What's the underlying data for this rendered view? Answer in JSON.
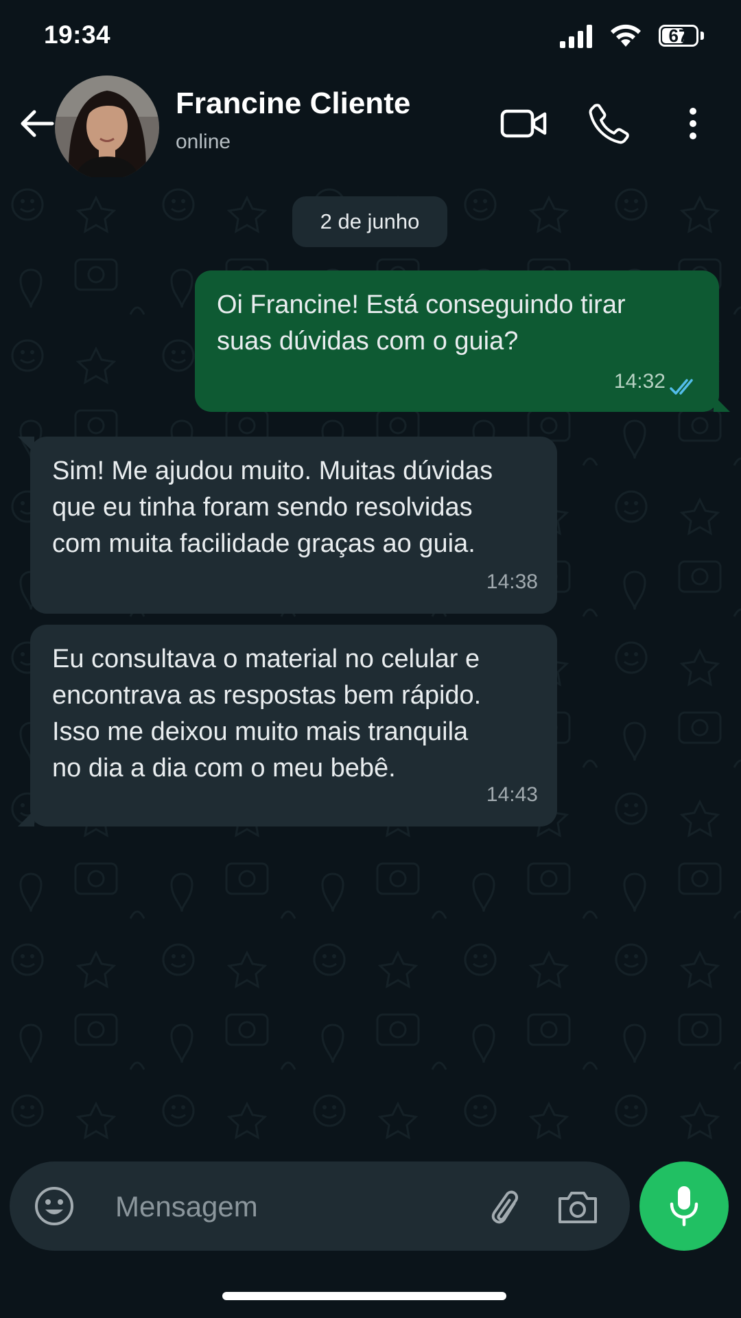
{
  "status_bar": {
    "time": "19:34",
    "battery": "67",
    "battery_level": 0.67
  },
  "header": {
    "contact_name": "Francine Cliente",
    "contact_status": "online",
    "icons": [
      "back-arrow-icon",
      "video-camera-icon",
      "phone-icon",
      "more-vertical-icon"
    ]
  },
  "chat": {
    "date_chip": "2 de junho",
    "messages": [
      {
        "direction": "outgoing",
        "text": "Oi Francine! Está conseguindo tirar\nsuas dúvidas com o guia?",
        "time": "14:32",
        "status": "read"
      },
      {
        "direction": "incoming",
        "text": "Sim! Me ajudou muito. Muitas dúvidas\nque eu tinha foram sendo resolvidas\ncom muita facilidade graças ao guia.",
        "time": "14:38"
      },
      {
        "direction": "incoming",
        "text": "Eu consultava o material no celular e\nencontrava as respostas bem rápido.\nIsso me deixou muito mais tranquila\nno dia a dia com o meu bebê.",
        "time": "14:43"
      }
    ]
  },
  "composer": {
    "placeholder": "Mensagem",
    "value": "",
    "icons": [
      "emoji-icon",
      "paperclip-icon",
      "camera-icon",
      "microphone-icon"
    ]
  },
  "colors": {
    "background": "#0b141a",
    "outgoing_bubble": "#0e5a33",
    "incoming_bubble": "#1f2c33",
    "accent": "#21c063",
    "read_ticks": "#53bdeb"
  }
}
